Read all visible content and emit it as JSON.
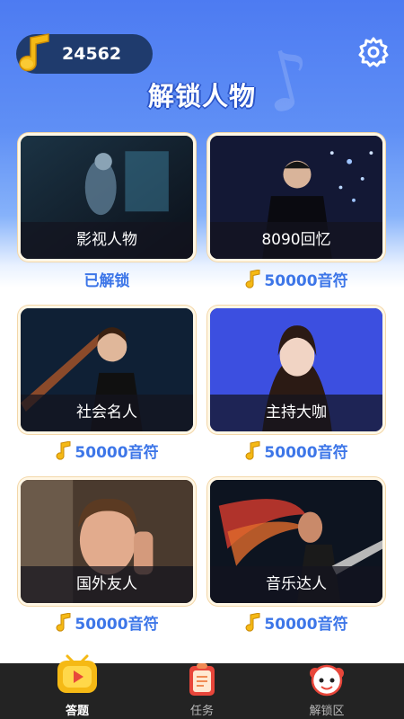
{
  "header": {
    "coin_count": "24562",
    "title": "解锁人物"
  },
  "cards": [
    {
      "label": "影视人物",
      "status": "已解锁",
      "unlocked": true
    },
    {
      "label": "8090回忆",
      "status": "50000音符",
      "unlocked": false
    },
    {
      "label": "社会名人",
      "status": "50000音符",
      "unlocked": false
    },
    {
      "label": "主持大咖",
      "status": "50000音符",
      "unlocked": false
    },
    {
      "label": "国外友人",
      "status": "50000音符",
      "unlocked": false
    },
    {
      "label": "音乐达人",
      "status": "50000音符",
      "unlocked": false
    }
  ],
  "nav": {
    "items": [
      {
        "label": "答题",
        "icon": "tv-play-icon",
        "active": true
      },
      {
        "label": "任务",
        "icon": "clipboard-icon",
        "active": false
      },
      {
        "label": "解锁区",
        "icon": "cartoon-face-icon",
        "active": false
      }
    ]
  },
  "colors": {
    "header_gradient_top": "#4d7bf2",
    "coin_pill": "#1f3b6d",
    "status_blue": "#3d76e8",
    "note_gold": "#f5b915",
    "nav_background": "#232323"
  }
}
